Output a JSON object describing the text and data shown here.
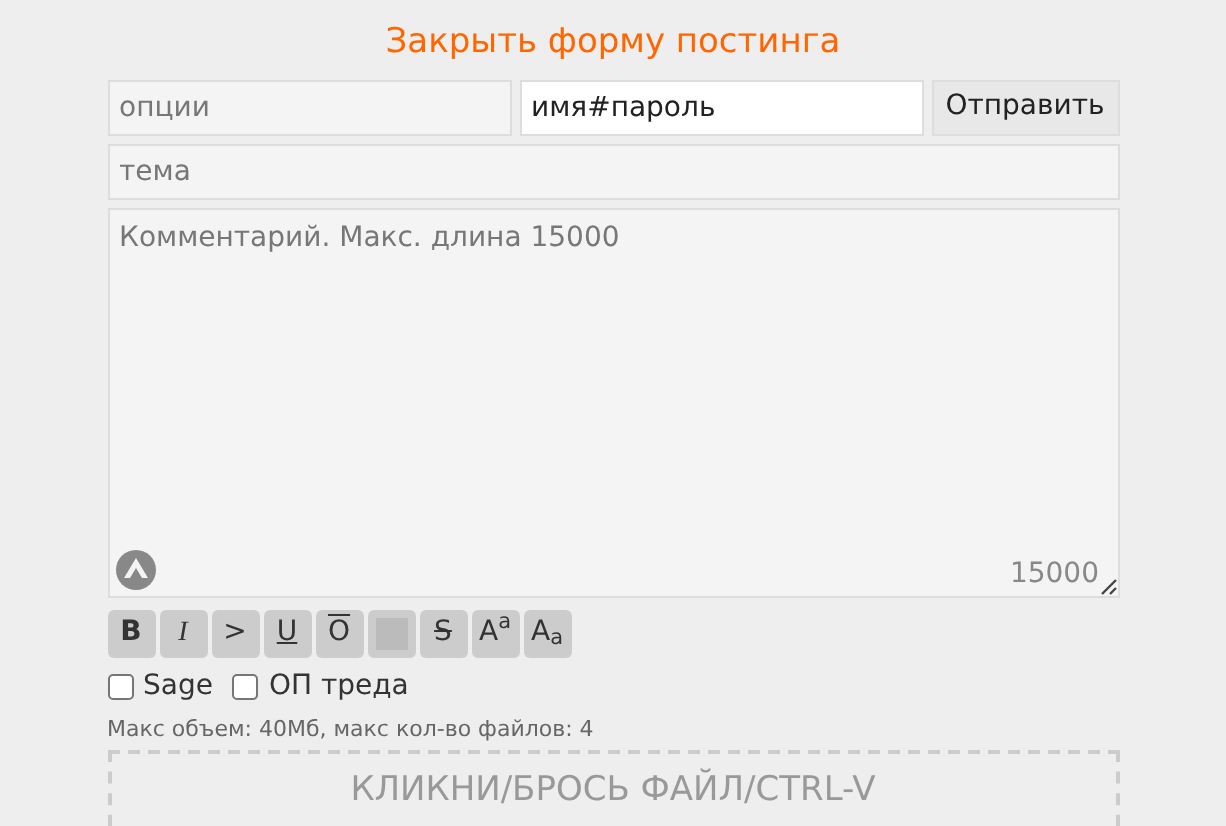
{
  "title": "Закрыть форму постинга",
  "options": {
    "placeholder": "опции"
  },
  "name": {
    "value": "имя#пароль"
  },
  "submit": "Отправить",
  "subject": {
    "placeholder": "тема"
  },
  "comment": {
    "placeholder": "Комментарий. Макс. длина 15000",
    "counter": "15000"
  },
  "markup_buttons": [
    {
      "kind": "bold",
      "label": "B"
    },
    {
      "kind": "italic",
      "label": "I"
    },
    {
      "kind": "quote",
      "label": ">"
    },
    {
      "kind": "underline",
      "label": "U"
    },
    {
      "kind": "overline",
      "label": "O"
    },
    {
      "kind": "spoiler"
    },
    {
      "kind": "strike",
      "label": "S"
    },
    {
      "kind": "sup",
      "label": "A$^{a}$"
    },
    {
      "kind": "sub",
      "label": "A$_{a}$"
    }
  ],
  "checkboxes": [
    {
      "label": "Sage",
      "checked": false
    },
    {
      "label": "ОП треда",
      "checked": false
    }
  ],
  "limits": "Макс объем: 40Мб, макс кол-во файлов: 4",
  "dropzone": "КЛИКНИ/БРОСЬ ФАЙЛ/CTRL-V"
}
